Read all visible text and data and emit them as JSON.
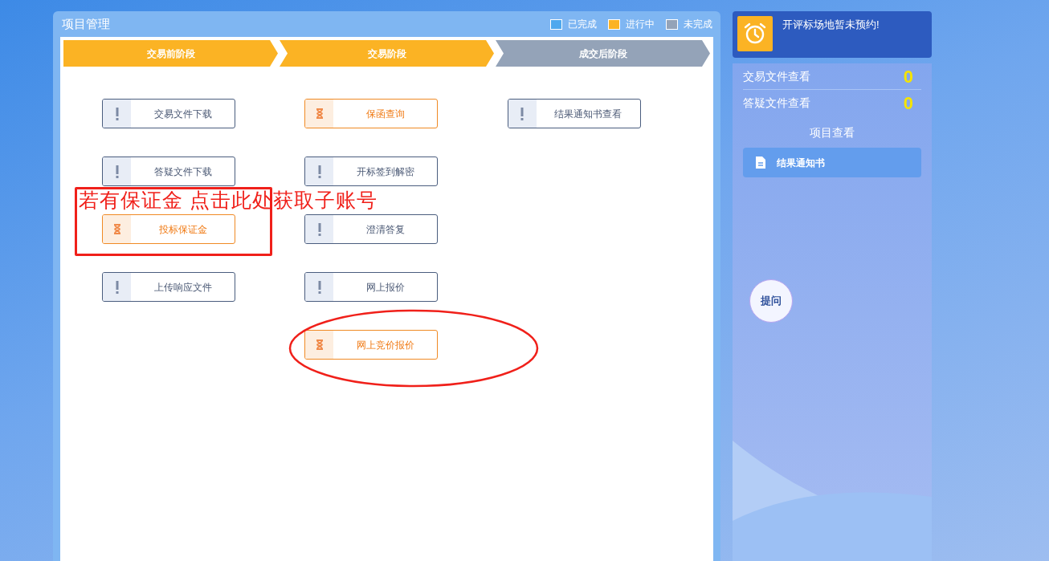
{
  "panel": {
    "title": "项目管理"
  },
  "legend": [
    {
      "label": "已完成",
      "color": "#4fa8ee"
    },
    {
      "label": "进行中",
      "color": "#fbb324"
    },
    {
      "label": "未完成",
      "color": "#94a3b8"
    }
  ],
  "stages": [
    {
      "label": "交易前阶段",
      "in_progress": true
    },
    {
      "label": "交易阶段",
      "in_progress": true
    },
    {
      "label": "成交后阶段",
      "in_progress": false
    }
  ],
  "task_columns": [
    [
      {
        "label": "交易文件下载",
        "in_progress": false
      },
      {
        "label": "答疑文件下载",
        "in_progress": false
      },
      {
        "label": "投标保证金",
        "in_progress": true
      },
      {
        "label": "上传响应文件",
        "in_progress": false
      }
    ],
    [
      {
        "label": "保函查询",
        "in_progress": true
      },
      {
        "label": "开标签到解密",
        "in_progress": false
      },
      {
        "label": "澄清答复",
        "in_progress": false
      },
      {
        "label": "网上报价",
        "in_progress": false
      },
      {
        "label": "网上竞价报价",
        "in_progress": true
      }
    ],
    [
      {
        "label": "结果通知书查看",
        "in_progress": false
      }
    ]
  ],
  "annotation": {
    "text": "若有保证金 点击此处获取子账号"
  },
  "sidebar": {
    "alert": "开评标场地暂未预约!",
    "counts": [
      {
        "label": "交易文件查看",
        "value": "0"
      },
      {
        "label": "答疑文件查看",
        "value": "0"
      }
    ],
    "section_title": "项目查看",
    "links": [
      {
        "label": "结果通知书"
      }
    ],
    "ask_button": "提问"
  }
}
